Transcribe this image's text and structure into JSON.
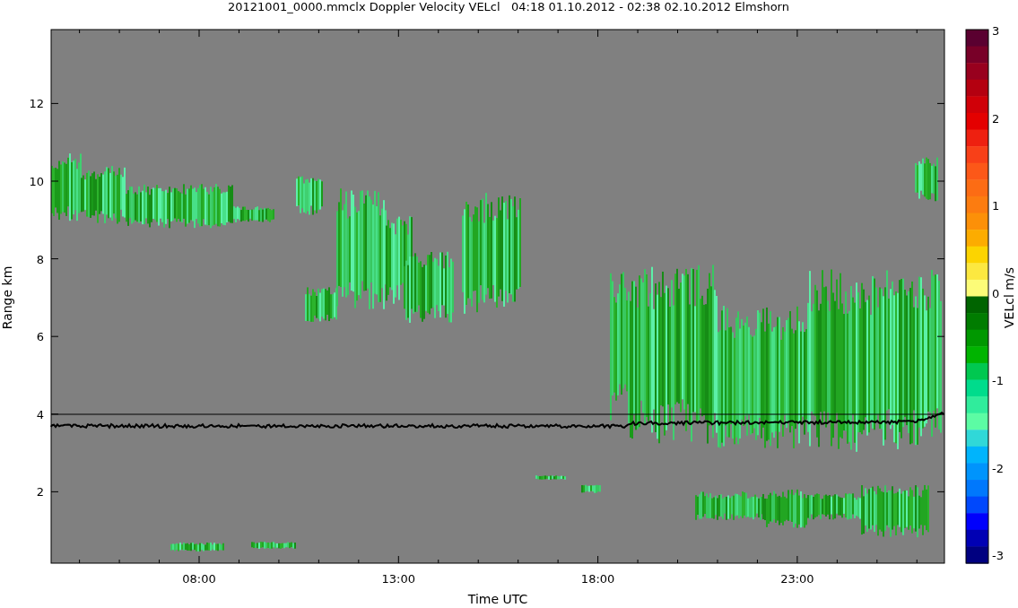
{
  "title": "20121001_0000.mmclx Doppler Velocity VELcl   04:18 01.10.2012 - 02:38 02.10.2012 Elmshorn",
  "y_axis": {
    "label": "Range km",
    "ticks": [
      "12",
      "10",
      "8",
      "6",
      "4",
      "2"
    ]
  },
  "x_axis": {
    "label": "Time UTC",
    "ticks": [
      "08:00",
      "13:00",
      "18:00",
      "23:00"
    ]
  },
  "colorbar": {
    "label": "VELcl m/s",
    "ticks": [
      "3",
      "2",
      "1",
      "0",
      "-1",
      "-2",
      "-3"
    ]
  }
}
